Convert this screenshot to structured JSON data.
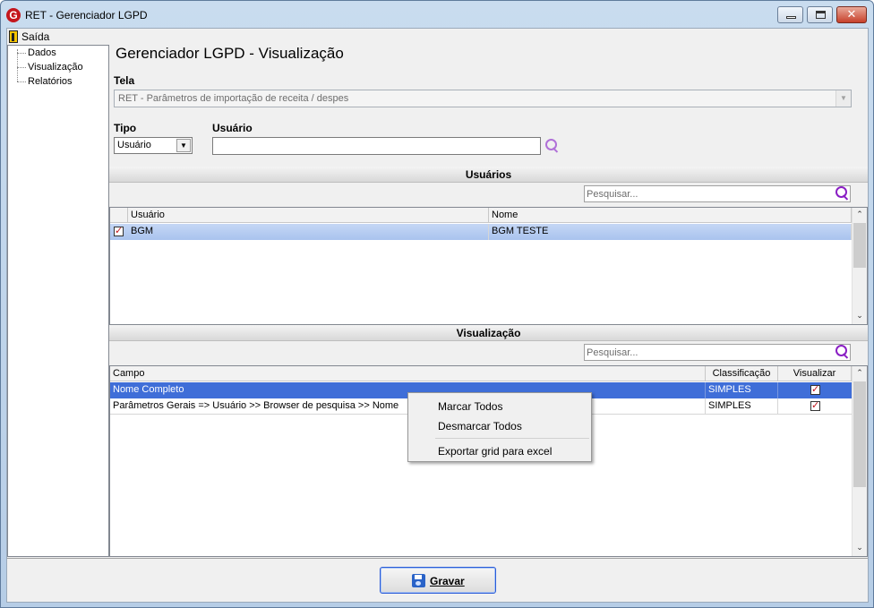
{
  "window": {
    "title": "RET - Gerenciador LGPD",
    "app_icon_letter": "G"
  },
  "menu": {
    "exit_label": "Saída"
  },
  "tree": {
    "items": [
      "Dados",
      "Visualização",
      "Relatórios"
    ]
  },
  "main": {
    "title": "Gerenciador LGPD - Visualização",
    "tela_label": "Tela",
    "tela_value": "RET - Parâmetros de importação de receita / despes",
    "tipo_label": "Tipo",
    "tipo_value": "Usuário",
    "usuario_label": "Usuário",
    "usuario_value": ""
  },
  "users_section": {
    "header": "Usuários",
    "search_placeholder": "Pesquisar...",
    "columns": [
      "Usuário",
      "Nome"
    ],
    "rows": [
      {
        "checked": true,
        "usuario": "BGM",
        "nome": "BGM TESTE"
      }
    ]
  },
  "view_section": {
    "header": "Visualização",
    "search_placeholder": "Pesquisar...",
    "columns": [
      "Campo",
      "Classificação",
      "Visualizar"
    ],
    "rows": [
      {
        "campo": "Nome Completo",
        "classificacao": "SIMPLES",
        "visualizar": true
      },
      {
        "campo": "Parâmetros Gerais => Usuário >> Browser de pesquisa >> Nome",
        "classificacao": "SIMPLES",
        "visualizar": true
      }
    ]
  },
  "context_menu": {
    "items": [
      "Marcar Todos",
      "Desmarcar Todos",
      "Exportar grid para excel"
    ]
  },
  "footer": {
    "save_label": "Gravar"
  },
  "colors": {
    "selection": "#3f6ed8",
    "accent_search": "#9b3fc4",
    "check": "#c0161c"
  }
}
